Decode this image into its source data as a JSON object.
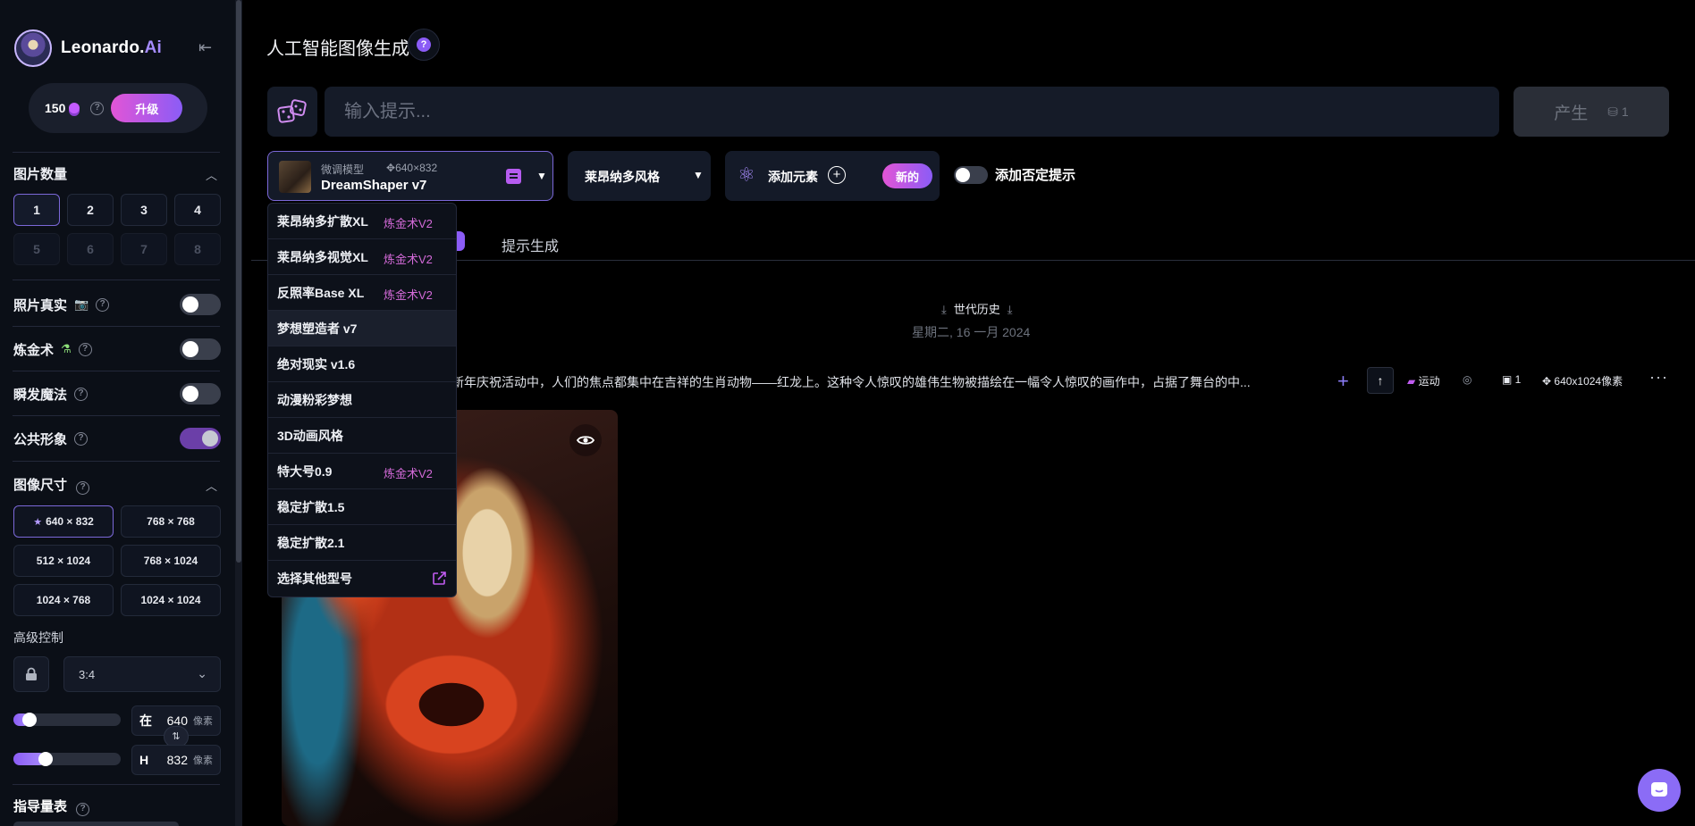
{
  "brand": {
    "name": "Leonardo.",
    "suffix": "Ai"
  },
  "credits": {
    "amount": "150",
    "upgrade_label": "升级"
  },
  "sidebar": {
    "image_count": {
      "title": "图片数量",
      "options": [
        "1",
        "2",
        "3",
        "4",
        "5",
        "6",
        "7",
        "8"
      ],
      "selected": "1"
    },
    "toggles": [
      {
        "label": "照片真实",
        "icon": "camera-icon",
        "on": false
      },
      {
        "label": "炼金术",
        "icon": "flask-icon",
        "on": false
      },
      {
        "label": "瞬发魔法",
        "icon": "",
        "on": false
      },
      {
        "label": "公共形象",
        "icon": "",
        "on": true
      }
    ],
    "image_size": {
      "title": "图像尺寸",
      "options": [
        "640 × 832",
        "768 × 768",
        "512 × 1024",
        "768 × 1024",
        "1024 × 768",
        "1024 × 1024"
      ],
      "selected": "640 × 832"
    },
    "advanced": {
      "title": "高级控制",
      "ratio": "3:4"
    },
    "width": {
      "key": "在",
      "value": "640",
      "unit": "像素",
      "fraction": 0.1
    },
    "height": {
      "key": "H",
      "value": "832",
      "unit": "像素",
      "fraction": 0.27
    },
    "guidance": {
      "title": "指导量表"
    }
  },
  "main": {
    "title": "人工智能图像生成",
    "prompt_placeholder": "输入提示...",
    "generate_label": "产生",
    "generate_cost": "1",
    "model": {
      "sub": "微调模型",
      "size": "640×832",
      "name": "DreamShaper v7"
    },
    "style": "莱昂纳多风格",
    "elements_label": "添加元素",
    "new_label": "新的",
    "negative_label": "添加否定提示",
    "tab_prompt": "提示生成",
    "history_title": "世代历史",
    "history_date": "星期二, 16 一月 2024",
    "gen_text": "新年庆祝活动中，人们的焦点都集中在吉祥的生肖动物——红龙上。这种令人惊叹的雄伟生物被描绘在一幅令人惊叹的画作中，占据了舞台的中...",
    "gen_meta": {
      "motion": "运动",
      "count": "1",
      "size": "640x1024像素"
    }
  },
  "model_dropdown": [
    {
      "label": "莱昂纳多扩散XL",
      "tag": "炼金术V2"
    },
    {
      "label": "莱昂纳多视觉XL",
      "tag": "炼金术V2"
    },
    {
      "label": "反照率Base XL",
      "tag": "炼金术V2"
    },
    {
      "label": "梦想塑造者 v7",
      "tag": ""
    },
    {
      "label": "绝对现实 v1.6",
      "tag": ""
    },
    {
      "label": "动漫粉彩梦想",
      "tag": ""
    },
    {
      "label": "3D动画风格",
      "tag": ""
    },
    {
      "label": "特大号0.9",
      "tag": "炼金术V2"
    },
    {
      "label": "稳定扩散1.5",
      "tag": ""
    },
    {
      "label": "稳定扩散2.1",
      "tag": ""
    },
    {
      "label": "选择其他型号",
      "tag": ""
    }
  ],
  "colors": {
    "accent": "#8b5cf6",
    "tag": "#d36ad8",
    "bg": "#000000"
  }
}
